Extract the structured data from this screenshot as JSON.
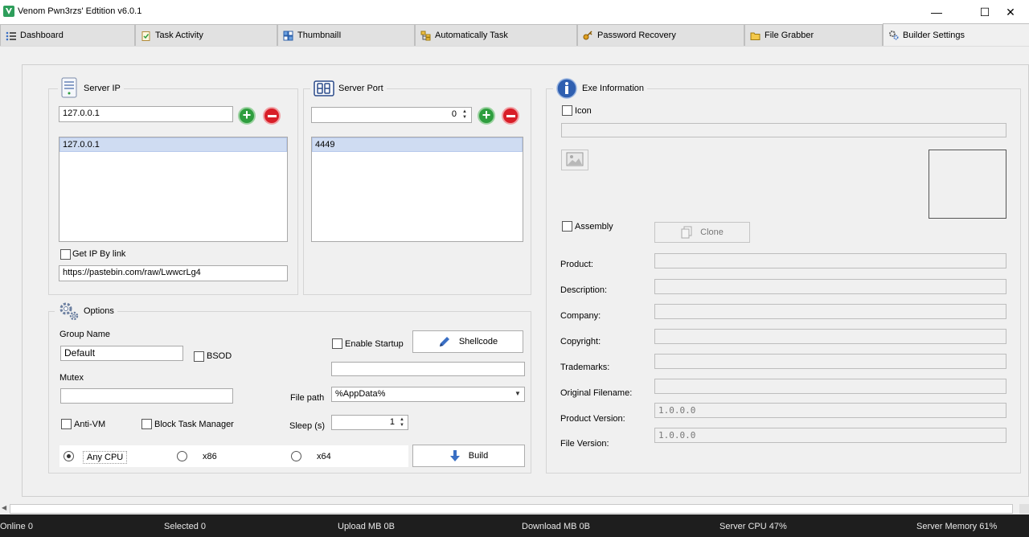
{
  "window": {
    "title": "Venom Pwn3rzs' Edtition v6.0.1",
    "minimize": "—",
    "maximize": "☐",
    "close": "✕"
  },
  "tabs": [
    {
      "label": "Dashboard",
      "icon": "list-icon"
    },
    {
      "label": "Task Activity",
      "icon": "clipboard-check-icon"
    },
    {
      "label": "ThumbnailI",
      "icon": "thumbnail-grid-icon"
    },
    {
      "label": "Automatically Task",
      "icon": "task-tree-icon"
    },
    {
      "label": "Password Recovery",
      "icon": "key-icon"
    },
    {
      "label": "File Grabber",
      "icon": "folder-icon"
    },
    {
      "label": "Builder Settings",
      "icon": "gears-icon",
      "active": true
    }
  ],
  "server_ip": {
    "legend": "Server IP",
    "input_value": "127.0.0.1",
    "list": [
      "127.0.0.1"
    ],
    "get_ip_by_link_label": "Get IP By link",
    "get_ip_by_link_checked": false,
    "link_value": "https://pastebin.com/raw/LwwcrLg4"
  },
  "server_port": {
    "legend": "Server Port",
    "icon_text": "88",
    "input_value": "0",
    "list": [
      "4449"
    ]
  },
  "options": {
    "legend": "Options",
    "group_name_label": "Group Name",
    "group_name_value": "Default",
    "bsod_label": "BSOD",
    "mutex_label": "Mutex",
    "mutex_value": "",
    "anti_vm_label": "Anti-VM",
    "block_task_manager_label": "Block Task Manager",
    "enable_startup_label": "Enable Startup",
    "shellcode_button": "Shellcode",
    "startup_name_value": "",
    "file_path_label": "File path",
    "file_path_value": "%AppData%",
    "sleep_label": "Sleep (s)",
    "sleep_value": "1",
    "cpu_options": [
      "Any CPU",
      "x86",
      "x64"
    ],
    "cpu_selected": "Any CPU",
    "build_button": "Build"
  },
  "exe_info": {
    "legend": "Exe Information",
    "icon_label": "Icon",
    "icon_path_value": "",
    "assembly_label": "Assembly",
    "clone_button": "Clone",
    "fields": [
      {
        "label": "Product:",
        "value": ""
      },
      {
        "label": "Description:",
        "value": ""
      },
      {
        "label": "Company:",
        "value": ""
      },
      {
        "label": "Copyright:",
        "value": ""
      },
      {
        "label": "Trademarks:",
        "value": ""
      },
      {
        "label": "Original Filename:",
        "value": ""
      },
      {
        "label": "Product Version:",
        "value": "1.0.0.0"
      },
      {
        "label": "File Version:",
        "value": "1.0.0.0"
      }
    ]
  },
  "status": {
    "online": "Online 0",
    "selected": "Selected 0",
    "upload": "Upload MB 0B",
    "download": "Download MB  0B",
    "cpu": "Server CPU 47%",
    "memory": "Server Memory 61%"
  },
  "colors": {
    "accent_green": "#2e9e3e",
    "accent_red": "#d81e28",
    "selection": "#cfdcf2",
    "statusbar_bg": "#1e1e1e"
  }
}
